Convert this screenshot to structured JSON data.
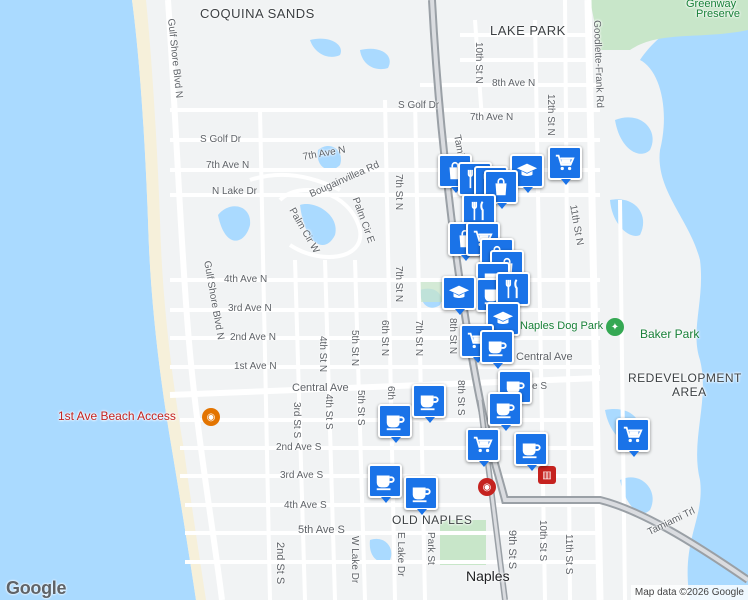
{
  "map": {
    "places": {
      "coquina_sands": "COQUINA SANDS",
      "lake_park": "LAKE PARK",
      "old_naples": "OLD NAPLES",
      "redevelopment_1": "REDEVELOPMENT",
      "redevelopment_2": "AREA",
      "naples": "Naples",
      "greenway_1": "Greenway",
      "greenway_2": "Preserve",
      "beach_access": "1st Ave Beach Access",
      "dog_park": "Naples Dog Park",
      "baker_park": "Baker Park"
    },
    "streets": {
      "gulf_shore_n1": "Gulf Shore Blvd N",
      "gulf_shore_n2": "Gulf Shore Blvd N",
      "goodlette": "Goodlette-Frank Rd",
      "tamiami": "Tamiami Trl",
      "s_golf_dr_1": "S Golf Dr",
      "s_golf_dr_2": "S Golf Dr",
      "ave7n_1": "7th Ave N",
      "ave7n_2": "7th Ave N",
      "ave7n_3": "7th Ave N",
      "ave8n": "8th Ave N",
      "n_lake_dr": "N Lake Dr",
      "bougainvillea": "Bougainvillea Rd",
      "palm_cir_e": "Palm Cir E",
      "palm_cir_w": "Palm Cir W",
      "ave4n": "4th Ave N",
      "ave3n": "3rd Ave N",
      "ave2n": "2nd Ave N",
      "ave1n": "1st Ave N",
      "central_ave_1": "Central Ave",
      "central_ave_2": "Central Ave",
      "ave2s": "2nd Ave S",
      "ave3s": "3rd Ave S",
      "ave4s": "4th Ave S",
      "ave5s": "5th Ave S",
      "st10n": "10th St N",
      "st12n": "12th St N",
      "st11n": "11th St N",
      "st7n_1": "7th St N",
      "st7n_2": "7th St N",
      "st7n_3": "7th St N",
      "st8n": "8th St N",
      "st6n": "6th St N",
      "st5n": "5th St N",
      "st4n": "4th St N",
      "st3s": "3rd St S",
      "st4s": "4th St S",
      "st5s": "5th St S",
      "st6s": "6th",
      "st8s": "8th St S",
      "st9s": "9th St S",
      "st10s": "10th St S",
      "st11s": "11th St S",
      "st2s": "2nd St S",
      "w_lake_dr": "W Lake Dr",
      "e_lake_dr": "E Lake Dr",
      "park_st": "Park St",
      "ave_e_s": "e S"
    },
    "logo": "Google",
    "attribution": "Map data ©2026 Google"
  },
  "colors": {
    "water": "#aadaff",
    "land": "#f1f3f4",
    "park": "#c8e6c9",
    "road": "#ffffff",
    "highway": "#9aa0a6",
    "pin": "#1a73e8"
  },
  "pins": [
    {
      "icon": "shopping-bag-icon"
    },
    {
      "icon": "shopping-cart-icon"
    },
    {
      "icon": "school-icon"
    },
    {
      "icon": "restaurant-icon"
    },
    {
      "icon": "restaurant-icon"
    },
    {
      "icon": "shopping-bag-icon"
    },
    {
      "icon": "restaurant-icon"
    },
    {
      "icon": "shopping-bag-icon"
    },
    {
      "icon": "shopping-cart-icon"
    },
    {
      "icon": "shopping-bag-icon"
    },
    {
      "icon": "shopping-bag-icon"
    },
    {
      "icon": "coffee-icon"
    },
    {
      "icon": "coffee-icon"
    },
    {
      "icon": "restaurant-icon"
    },
    {
      "icon": "school-icon"
    },
    {
      "icon": "school-icon"
    },
    {
      "icon": "shopping-cart-icon"
    },
    {
      "icon": "coffee-icon"
    },
    {
      "icon": "coffee-icon"
    },
    {
      "icon": "coffee-icon"
    },
    {
      "icon": "coffee-icon"
    },
    {
      "icon": "coffee-icon"
    },
    {
      "icon": "shopping-cart-icon"
    },
    {
      "icon": "coffee-icon"
    },
    {
      "icon": "shopping-cart-icon"
    },
    {
      "icon": "coffee-icon"
    },
    {
      "icon": "coffee-icon"
    }
  ]
}
